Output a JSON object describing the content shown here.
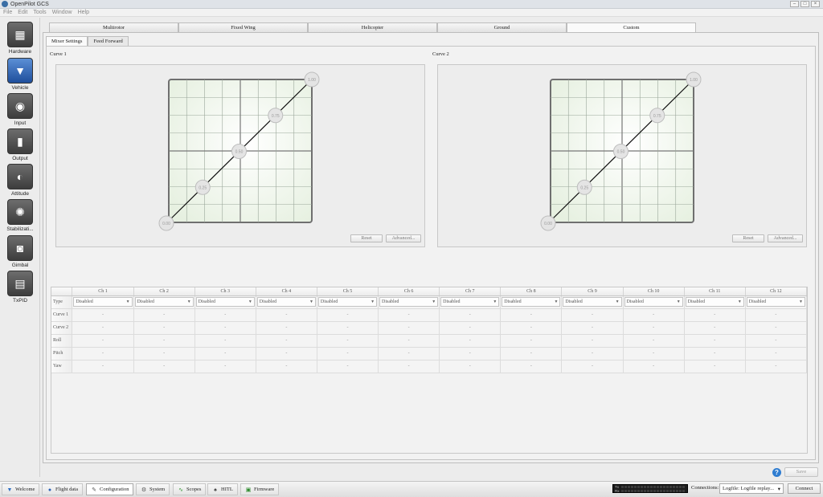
{
  "window": {
    "title": "OpenPilot GCS"
  },
  "menu": [
    "File",
    "Edit",
    "Tools",
    "Window",
    "Help"
  ],
  "sidebar": [
    {
      "label": "Hardware",
      "icon": "chip-icon"
    },
    {
      "label": "Vehicle",
      "icon": "vehicle-icon"
    },
    {
      "label": "Input",
      "icon": "transmitter-icon"
    },
    {
      "label": "Output",
      "icon": "motor-icon"
    },
    {
      "label": "Attitude",
      "icon": "attitude-icon"
    },
    {
      "label": "Stabilizati...",
      "icon": "gyro-icon"
    },
    {
      "label": "Gimbal",
      "icon": "camera-icon"
    },
    {
      "label": "TxPID",
      "icon": "txpid-icon"
    }
  ],
  "vehicle_tabs": [
    "Multirotor",
    "Fixed Wing",
    "Helicopter",
    "Ground",
    "Custom"
  ],
  "sub_tabs": [
    "Mixer Settings",
    "Feed Forward"
  ],
  "curve1": {
    "label": "Curve 1",
    "points": [
      "0.00",
      "0.25",
      "0.50",
      "0.75",
      "1.00"
    ],
    "reset": "Reset",
    "advanced": "Advanced..."
  },
  "curve2": {
    "label": "Curve 2",
    "points": [
      "0.00",
      "0.25",
      "0.50",
      "0.75",
      "1.00"
    ],
    "reset": "Reset",
    "advanced": "Advanced..."
  },
  "mixer": {
    "channels": [
      "Ch 1",
      "Ch 2",
      "Ch 3",
      "Ch 4",
      "Ch 5",
      "Ch 6",
      "Ch 7",
      "Ch 8",
      "Ch 9",
      "Ch 10",
      "Ch 11",
      "Ch 12"
    ],
    "type_label": "Type",
    "type_value": "Disabled",
    "rows": [
      "Curve 1",
      "Curve 2",
      "Roll",
      "Pitch",
      "Yaw"
    ],
    "cell_value": "-"
  },
  "bottom": {
    "save": "Save",
    "help": "?"
  },
  "modes": [
    {
      "label": "Welcome",
      "icon": "welcome-icon"
    },
    {
      "label": "Flight data",
      "icon": "globe-icon"
    },
    {
      "label": "Configuration",
      "icon": "wrench-icon"
    },
    {
      "label": "System",
      "icon": "gears-icon"
    },
    {
      "label": "Scopes",
      "icon": "scope-icon"
    },
    {
      "label": "HITL",
      "icon": "gamepad-icon"
    },
    {
      "label": "Firmware",
      "icon": "board-icon"
    }
  ],
  "status": {
    "tx": "Tx",
    "rx": "Rx",
    "connections_label": "Connections:",
    "connection_value": "Logfile: Logfile replay...",
    "connect": "Connect"
  }
}
